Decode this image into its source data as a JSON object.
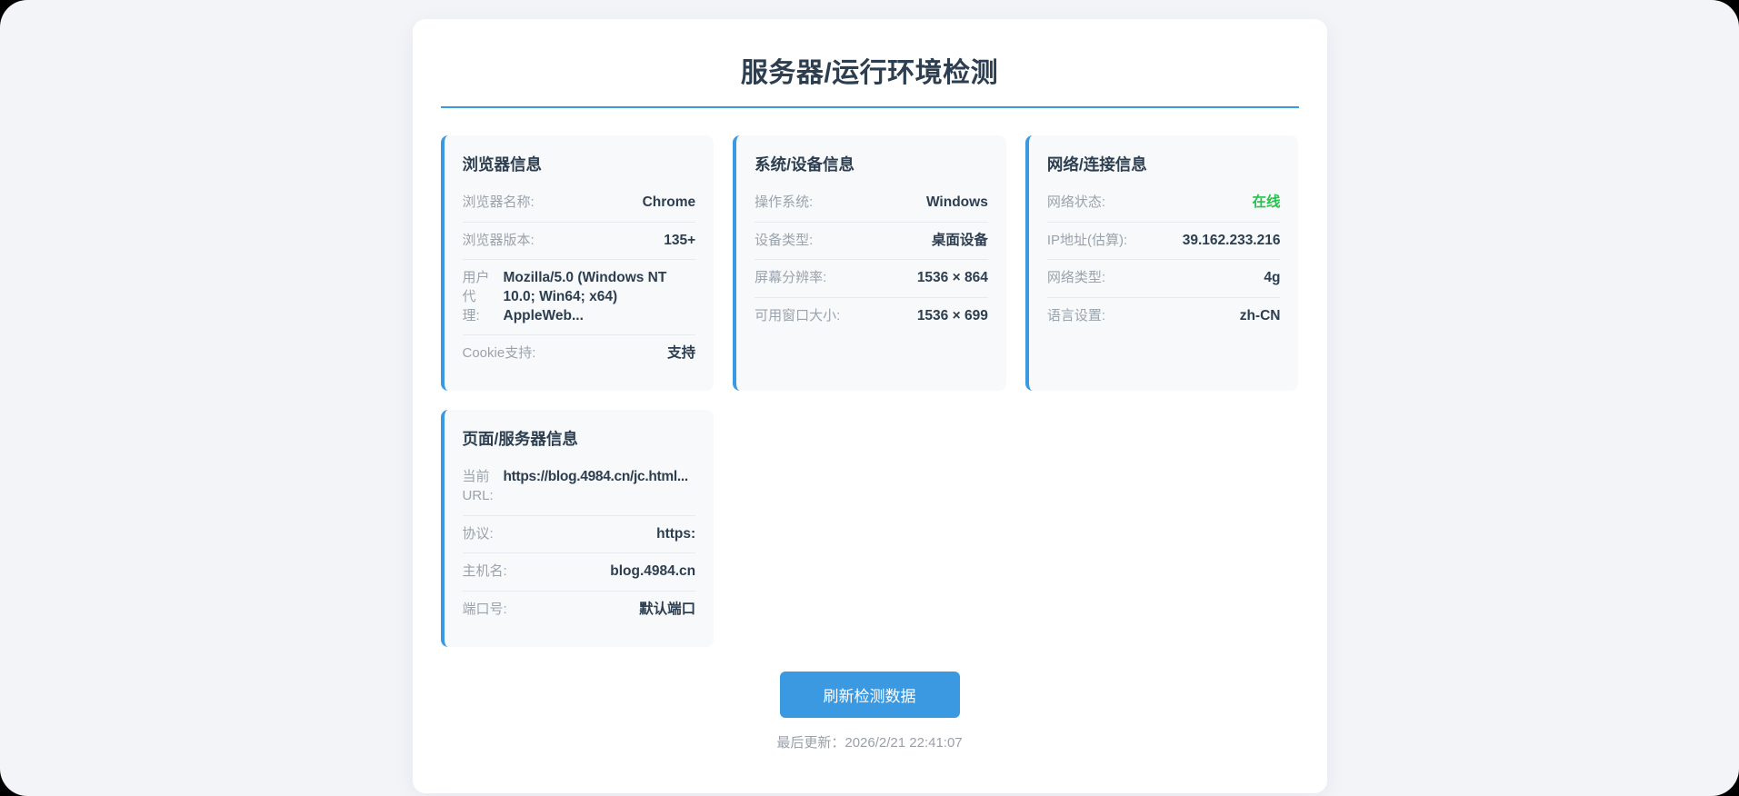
{
  "page": {
    "title": "服务器/运行环境检测",
    "refresh_button": "刷新检测数据",
    "last_update_label": "最后更新：",
    "last_update_time": "2026/2/21 22:41:07"
  },
  "colors": {
    "accent_blue": "#3a99e0",
    "online_green": "#27c24c",
    "heading_dark": "#2c3e50",
    "label_gray": "#9aa3ac",
    "page_background": "#f3f4f8",
    "card_background": "#f8f9fb"
  },
  "cards": {
    "browser": {
      "title": "浏览器信息",
      "rows": [
        {
          "label": "浏览器名称:",
          "value": "Chrome"
        },
        {
          "label": "浏览器版本:",
          "value": "135+"
        },
        {
          "label": "用户代理:",
          "value": "Mozilla/5.0 (Windows NT 10.0; Win64; x64) AppleWeb..."
        },
        {
          "label": "Cookie支持:",
          "value": "支持"
        }
      ]
    },
    "system": {
      "title": "系统/设备信息",
      "rows": [
        {
          "label": "操作系统:",
          "value": "Windows"
        },
        {
          "label": "设备类型:",
          "value": "桌面设备"
        },
        {
          "label": "屏幕分辨率:",
          "value": "1536 × 864"
        },
        {
          "label": "可用窗口大小:",
          "value": "1536 × 699"
        }
      ]
    },
    "network": {
      "title": "网络/连接信息",
      "rows": [
        {
          "label": "网络状态:",
          "value": "在线"
        },
        {
          "label": "IP地址(估算):",
          "value": "39.162.233.216"
        },
        {
          "label": "网络类型:",
          "value": "4g"
        },
        {
          "label": "语言设置:",
          "value": "zh-CN"
        }
      ]
    },
    "server": {
      "title": "页面/服务器信息",
      "rows": [
        {
          "label": "当前URL:",
          "value": "https://blog.4984.cn/jc.html..."
        },
        {
          "label": "协议:",
          "value": "https:"
        },
        {
          "label": "主机名:",
          "value": "blog.4984.cn"
        },
        {
          "label": "端口号:",
          "value": "默认端口"
        }
      ]
    }
  }
}
